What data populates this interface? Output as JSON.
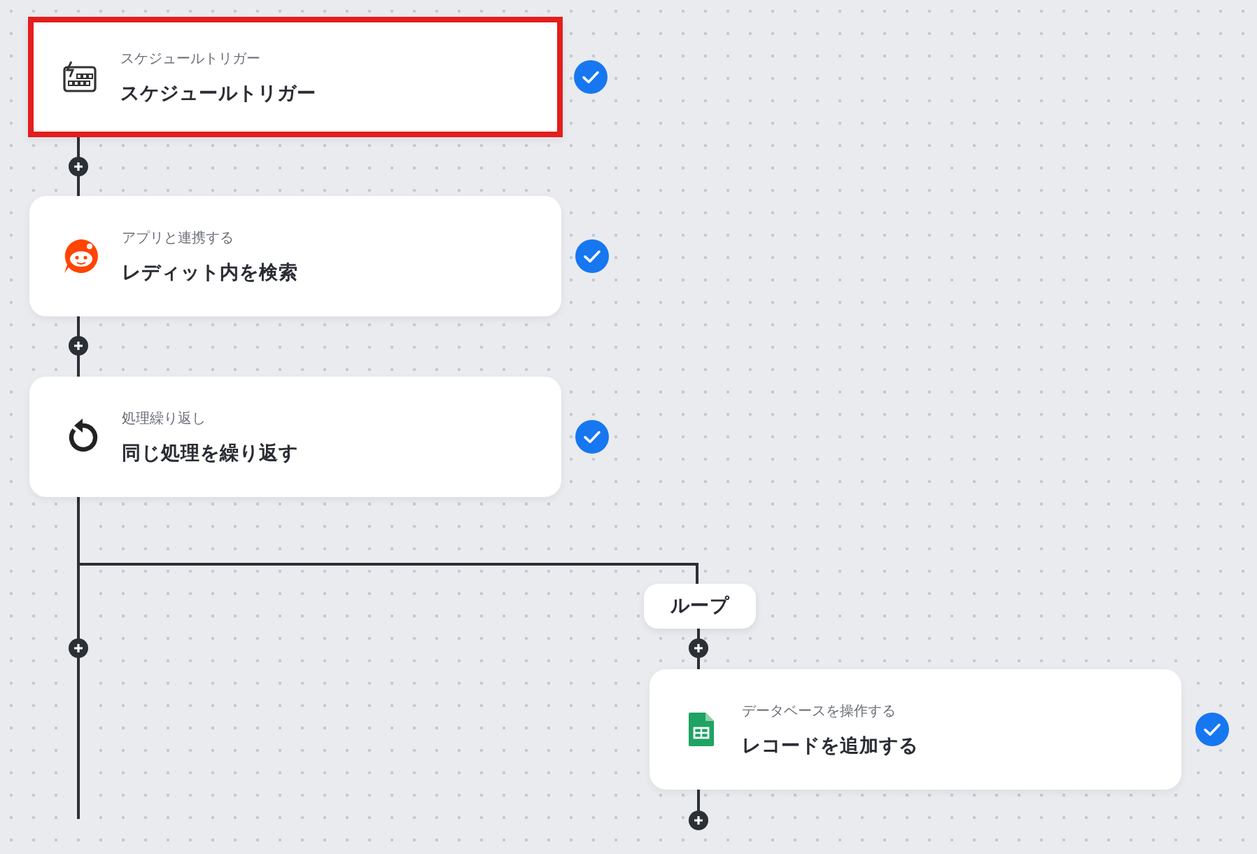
{
  "steps": [
    {
      "kind": "schedule",
      "category": "スケジュールトリガー",
      "title": "スケジュールトリガー",
      "highlighted": true,
      "completed": true
    },
    {
      "kind": "reddit",
      "category": "アプリと連携する",
      "title": "レディット内を検索",
      "highlighted": false,
      "completed": true
    },
    {
      "kind": "loop",
      "category": "処理繰り返し",
      "title": "同じ処理を繰り返す",
      "highlighted": false,
      "completed": true
    },
    {
      "kind": "sheet",
      "category": "データベースを操作する",
      "title": "レコードを追加する",
      "highlighted": false,
      "completed": true
    }
  ],
  "branch": {
    "label": "ループ"
  }
}
